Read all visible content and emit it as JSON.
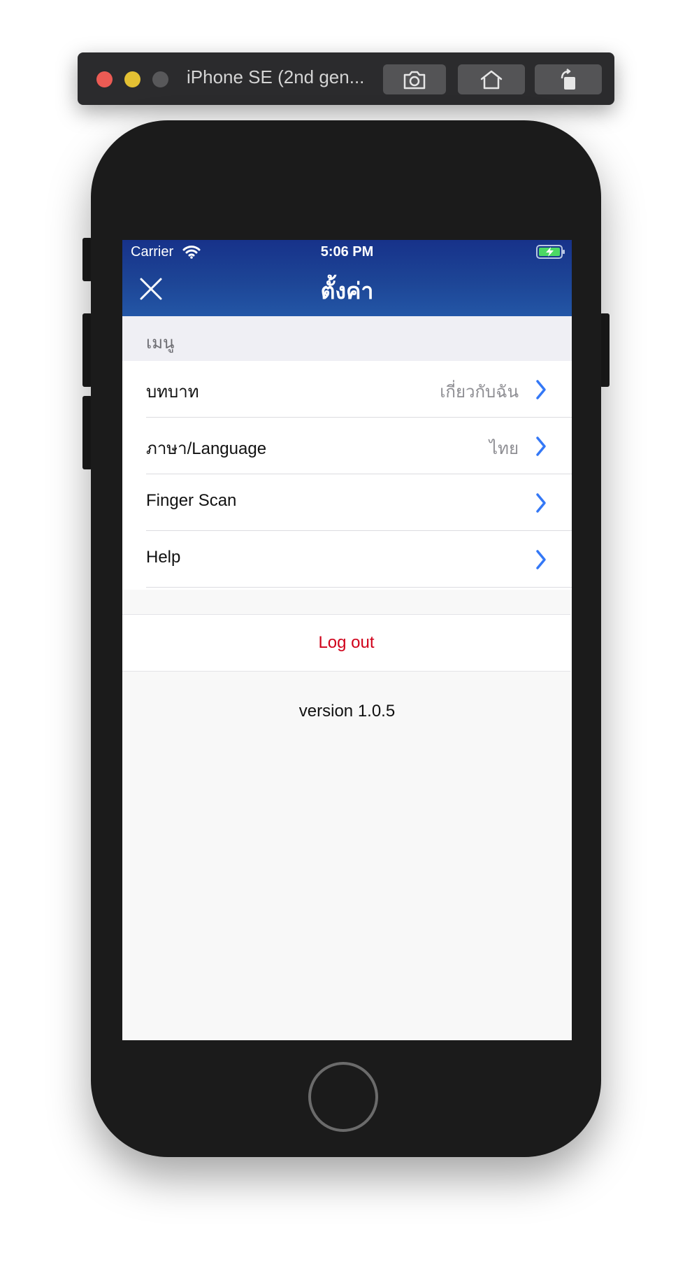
{
  "simulator": {
    "title": "iPhone SE (2nd gen...",
    "buttons": [
      "screenshot-icon",
      "home-icon",
      "rotate-icon"
    ]
  },
  "status_bar": {
    "carrier": "Carrier",
    "time": "5:06 PM",
    "icons": [
      "wifi-icon",
      "battery-charging-icon"
    ]
  },
  "nav": {
    "title": "ตั้งค่า",
    "close_icon": "close-icon"
  },
  "section": {
    "header": "เมนู"
  },
  "menu": {
    "items": [
      {
        "label": "บทบาท",
        "value": "เกี่ยวกับฉัน"
      },
      {
        "label": "ภาษา/Language",
        "value": "ไทย"
      },
      {
        "label": "Finger Scan",
        "value": ""
      },
      {
        "label": "Help",
        "value": ""
      }
    ]
  },
  "logout": {
    "label": "Log out"
  },
  "footer": {
    "version": "version 1.0.5"
  },
  "colors": {
    "nav_gradient_top": "#17328a",
    "nav_gradient_bottom": "#2356a6",
    "chevron": "#3478f6",
    "logout_text": "#d0021b",
    "battery_fill": "#4cd964"
  }
}
